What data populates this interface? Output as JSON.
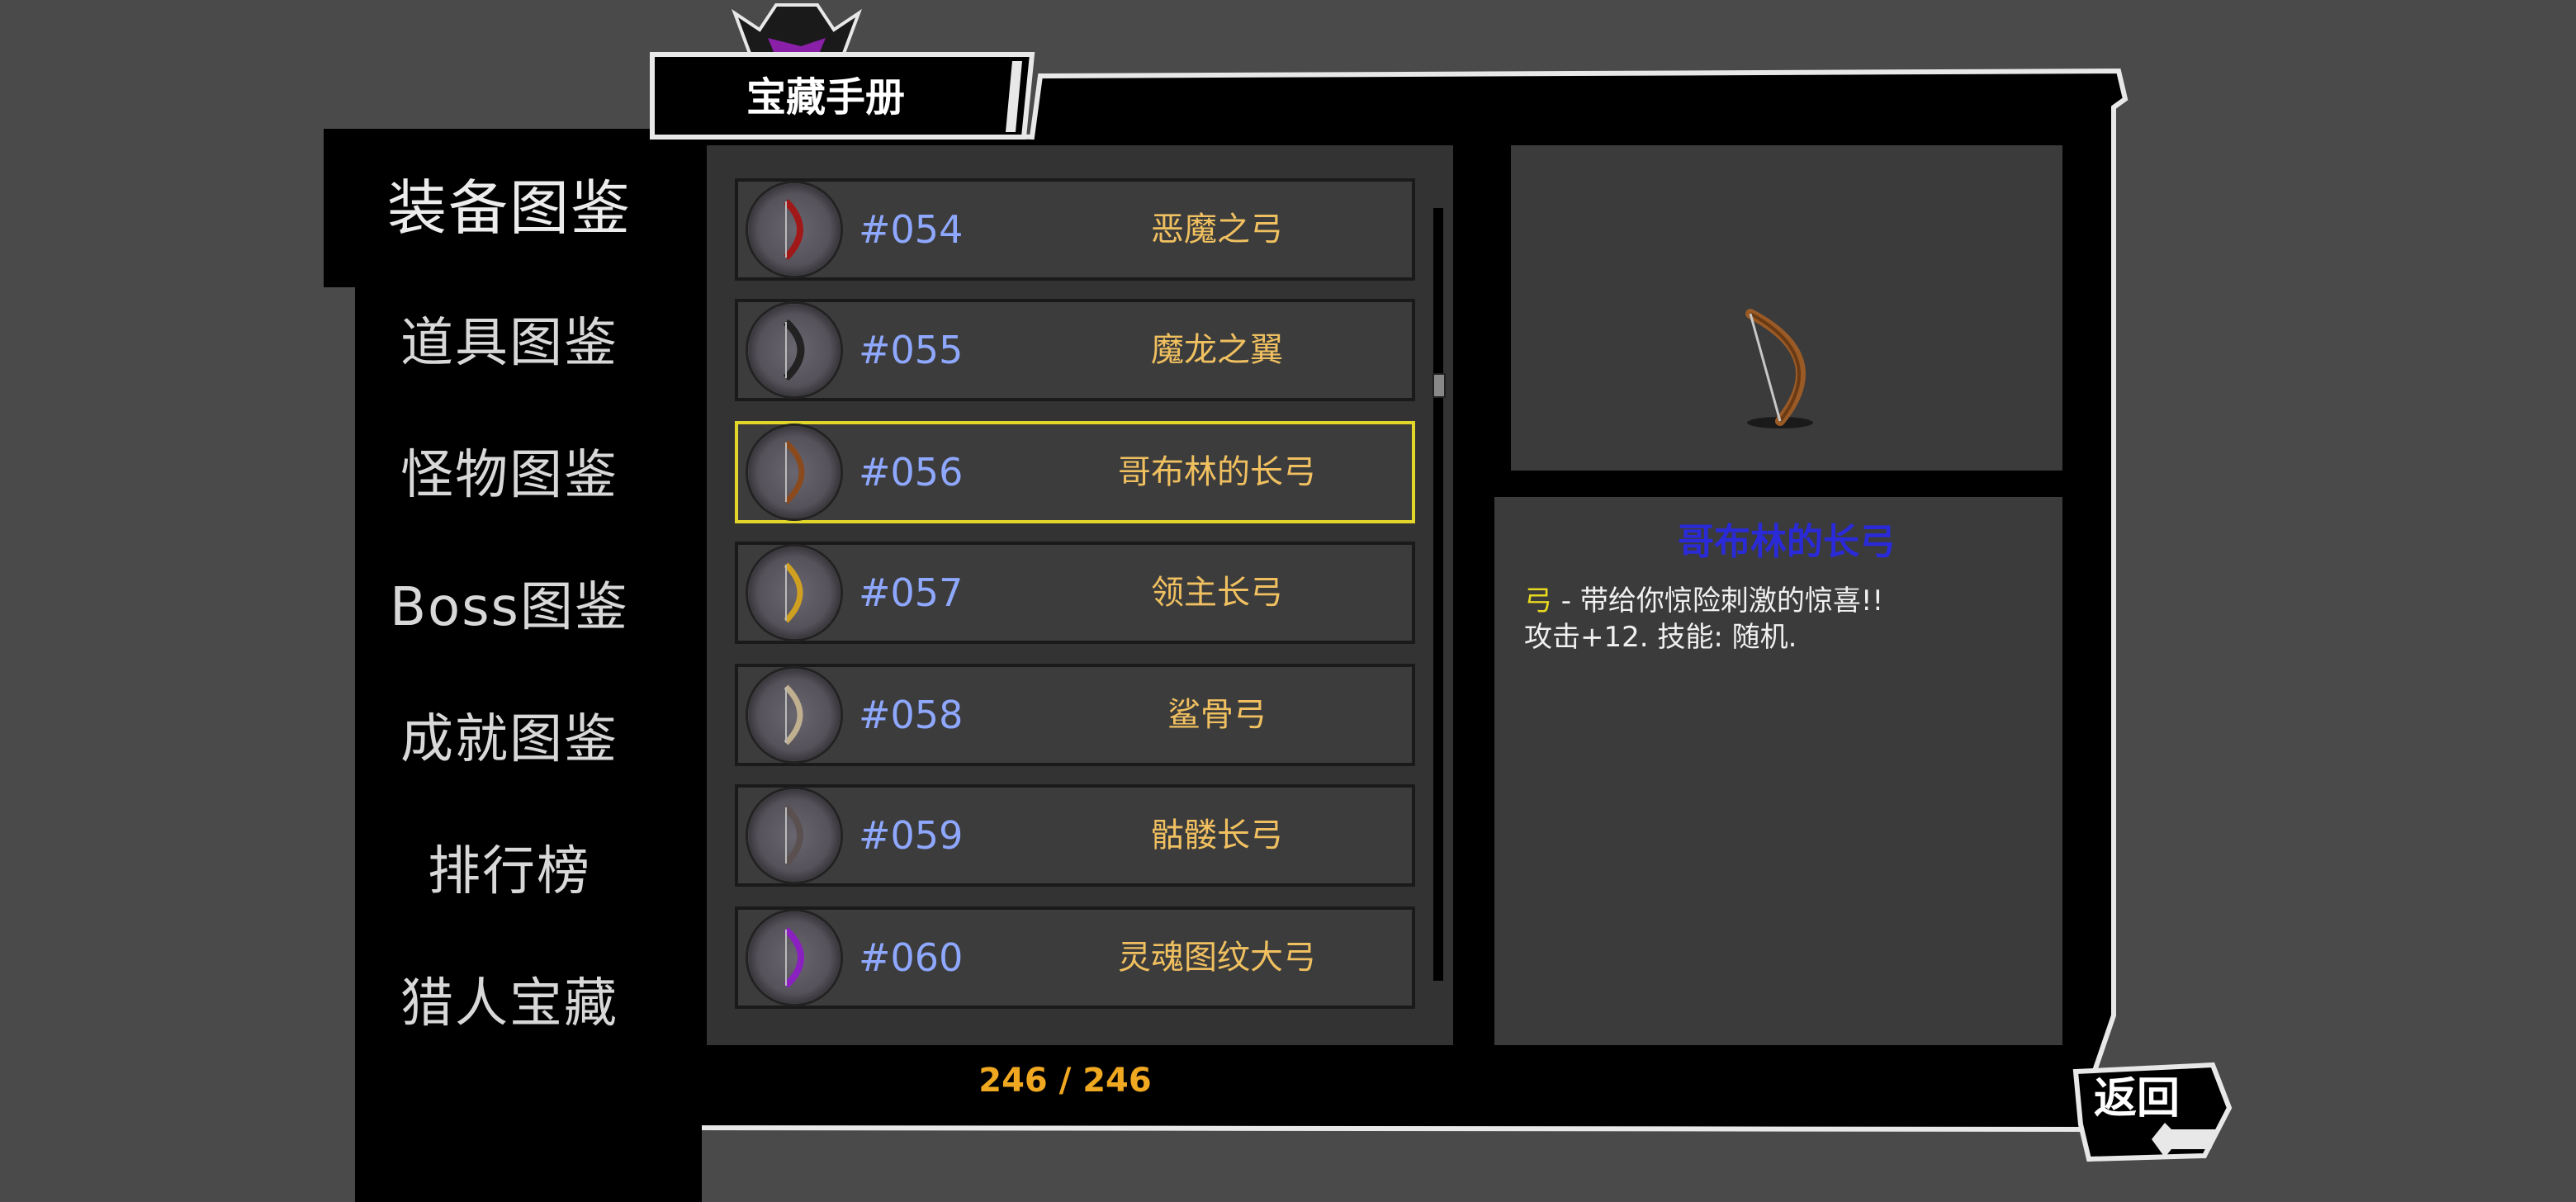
{
  "title": "宝藏手册",
  "sidebar": {
    "items": [
      {
        "label": "装备图鉴",
        "selected": true
      },
      {
        "label": "道具图鉴"
      },
      {
        "label": "怪物图鉴"
      },
      {
        "label": "Boss图鉴"
      },
      {
        "label": "成就图鉴"
      },
      {
        "label": "排行榜"
      },
      {
        "label": "猎人宝藏"
      }
    ]
  },
  "list": {
    "rows": [
      {
        "num": "#054",
        "name": "恶魔之弓",
        "icon": "demon-bow-icon",
        "color": "#a01818"
      },
      {
        "num": "#055",
        "name": "魔龙之翼",
        "icon": "dragon-wing-bow-icon",
        "color": "#222222"
      },
      {
        "num": "#056",
        "name": "哥布林的长弓",
        "icon": "goblin-longbow-icon",
        "color": "#8a4a1e",
        "selected": true
      },
      {
        "num": "#057",
        "name": "领主长弓",
        "icon": "lord-longbow-icon",
        "color": "#d0a020"
      },
      {
        "num": "#058",
        "name": "鲨骨弓",
        "icon": "shark-bone-bow-icon",
        "color": "#c0b090"
      },
      {
        "num": "#059",
        "name": "骷髅长弓",
        "icon": "skull-longbow-icon",
        "color": "#5a5050"
      },
      {
        "num": "#060",
        "name": "灵魂图纹大弓",
        "icon": "soul-rune-bow-icon",
        "color": "#8a20c0"
      }
    ]
  },
  "detail": {
    "title": "哥布林的长弓",
    "type": "弓",
    "line1_rest": " - 带给你惊险刺激的惊喜!!",
    "line2": "攻击+12. 技能: 随机."
  },
  "counter": "246 / 246",
  "back_label": "返回",
  "colors": {
    "background": "#4a4a4a",
    "panel": "#333333",
    "number": "#8fa8ff",
    "item_name": "#f0c060",
    "selected_border": "#e2d62a",
    "detail_title": "#2a2ad8",
    "counter": "#f0a820"
  }
}
